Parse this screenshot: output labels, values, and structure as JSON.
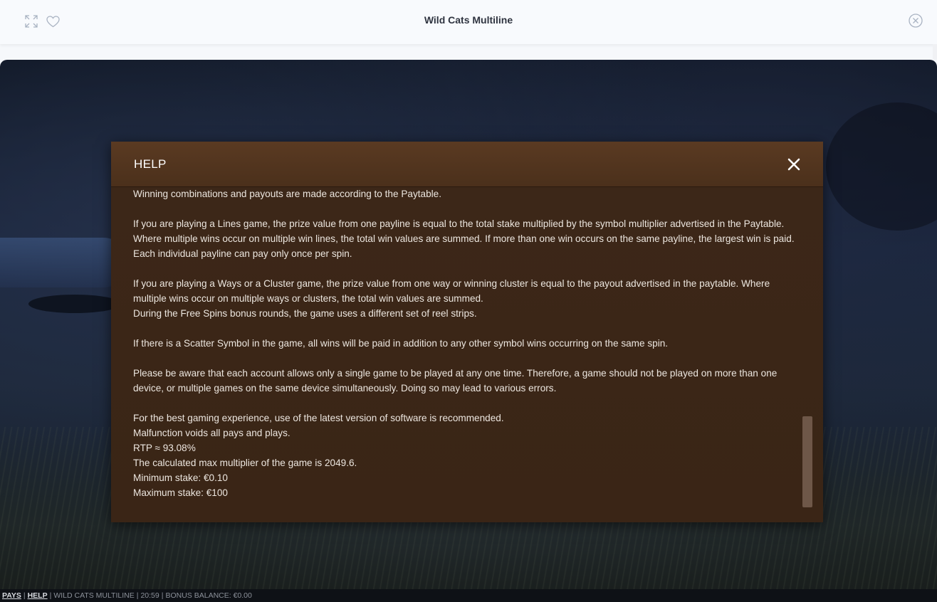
{
  "topbar": {
    "title": "Wild Cats Multiline",
    "icons": [
      "expand-icon",
      "heart-icon",
      "close-circle-icon"
    ]
  },
  "modal": {
    "title": "HELP",
    "paragraphs": [
      [
        "Winning combinations and payouts are made according to the Paytable."
      ],
      [
        "If you are playing a Lines game, the prize value from one payline is equal to the total stake multiplied by the symbol multiplier advertised in the Paytable. Where multiple wins occur on multiple win lines, the total win values are summed. If more than one win occurs on the same payline, the largest win is paid. Each individual payline can pay only once per spin."
      ],
      [
        "If you are playing a Ways or a Cluster game, the prize value from one way or winning cluster is equal to the payout advertised in the paytable. Where multiple wins occur on multiple ways or clusters, the total win values are summed.",
        "During the Free Spins bonus rounds, the game uses a different set of reel strips."
      ],
      [
        "If there is a Scatter Symbol in the game, all wins will be paid in addition to any other symbol wins occurring on the same spin."
      ],
      [
        "Please be aware that each account allows only a single game to be played at any one time. Therefore, a game should not be played on more than one device, or multiple games on the same device simultaneously. Doing so may lead to various errors."
      ],
      [
        "For the best gaming experience, use of the latest version of software is recommended.",
        "Malfunction voids all pays and plays.",
        "RTP ≈ 93.08%",
        "The calculated max multiplier of the game is 2049.6.",
        "Minimum stake: €0.10",
        "Maximum stake: €100"
      ]
    ]
  },
  "statusbar": {
    "pays": "PAYS",
    "help": "HELP",
    "game_name": "WILD CATS MULTILINE",
    "time": "20:59",
    "bonus_balance": "BONUS BALANCE: €0.00"
  },
  "colors": {
    "modal_bg": "#3a2618",
    "modal_header": "#5a3a22",
    "text": "#ece6df",
    "scrollbar_thumb": "#6e5748"
  }
}
